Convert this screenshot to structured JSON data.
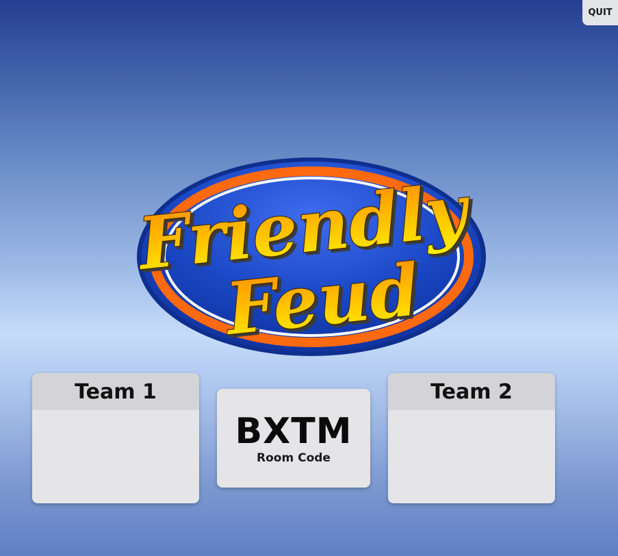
{
  "header": {
    "quit_label": "QUIT"
  },
  "logo": {
    "line1": "Friendly",
    "line2": "Feud",
    "colors": {
      "oval_outer": "#1f3fa8",
      "oval_inner": "#1140b8",
      "ring_orange": "#ff6a10",
      "ring_white": "#ffffff",
      "text_gold_top": "#ff9a00",
      "text_gold_bottom": "#fff200"
    }
  },
  "teams": [
    {
      "name": "Team 1"
    },
    {
      "name": "Team 2"
    }
  ],
  "room": {
    "code": "BXTM",
    "label": "Room Code"
  }
}
